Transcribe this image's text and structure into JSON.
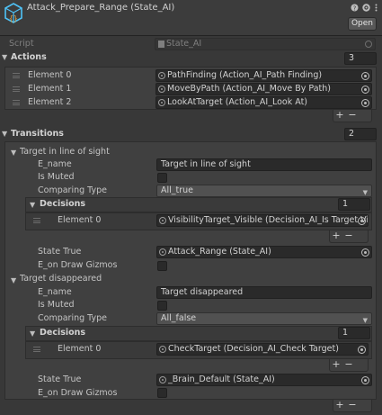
{
  "header": {
    "title": "Attack_Prepare_Range (State_AI)",
    "open_label": "Open",
    "icon_help": "help-icon",
    "icon_settings": "settings-icon",
    "icon_menu": "kebab-menu-icon"
  },
  "script": {
    "label": "Script",
    "value": "State_AI"
  },
  "actions": {
    "label": "Actions",
    "count": "3",
    "items": [
      {
        "label": "Element 0",
        "value": "PathFinding (Action_AI_Path Finding)"
      },
      {
        "label": "Element 1",
        "value": "MoveByPath (Action_AI_Move By Path)"
      },
      {
        "label": "Element 2",
        "value": "LookAtTarget (Action_AI_Look At)"
      }
    ]
  },
  "transitions": {
    "label": "Transitions",
    "count": "2",
    "items": [
      {
        "header": "Target in line of sight",
        "e_name_label": "E_name",
        "e_name": "Target in line of sight",
        "muted_label": "Is Muted",
        "comparing_label": "Comparing Type",
        "comparing": "All_true",
        "decisions_label": "Decisions",
        "decisions_count": "1",
        "decision_el_label": "Element 0",
        "decision": "VisibilityTarget_Visible (Decision_AI_Is Target Visi",
        "state_true_label": "State True",
        "state_true": "Attack_Range (State_AI)",
        "gizmos_label": "E_on Draw Gizmos"
      },
      {
        "header": "Target disappeared",
        "e_name_label": "E_name",
        "e_name": "Target disappeared",
        "muted_label": "Is Muted",
        "comparing_label": "Comparing Type",
        "comparing": "All_false",
        "decisions_label": "Decisions",
        "decisions_count": "1",
        "decision_el_label": "Element 0",
        "decision": "CheckTarget (Decision_AI_Check Target)",
        "state_true_label": "State True",
        "state_true": "_Brain_Default (State_AI)",
        "gizmos_label": "E_on Draw Gizmos"
      }
    ]
  },
  "buttons": {
    "add": "+",
    "remove": "−"
  },
  "colors": {
    "background": "#383838",
    "field": "#2a2a2a",
    "logo": "#4fc3f7",
    "accent_logo": "#e8a33d"
  }
}
